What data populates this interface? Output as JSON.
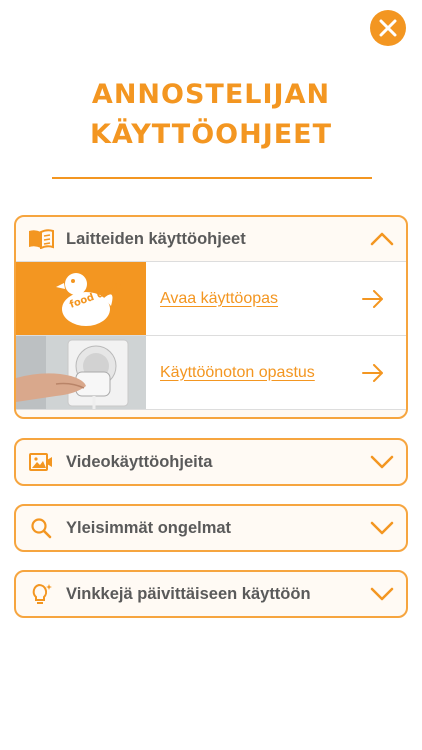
{
  "title": {
    "line1": "ANNOSTELIJAN",
    "line2": "KÄYTTÖOHJEET"
  },
  "close_icon": "close-icon",
  "sections": [
    {
      "label": "Laitteiden käyttöohjeet",
      "icon": "book-icon",
      "expanded": true,
      "items": [
        {
          "label": "Avaa käyttöopas",
          "thumbnail": "foodduck-logo",
          "logo_text": "food duck"
        },
        {
          "label": "Käyttöönoton opastus",
          "thumbnail": "hand-plugging-device-photo"
        }
      ]
    },
    {
      "label": "Videokäyttöohjeita",
      "icon": "image-icon",
      "expanded": false
    },
    {
      "label": "Yleisimmät ongelmat",
      "icon": "search-icon",
      "expanded": false
    },
    {
      "label": "Vinkkejä päivittäiseen käyttöön",
      "icon": "lightbulb-icon",
      "expanded": false
    }
  ],
  "colors": {
    "accent": "#f39621",
    "border": "#f6a53f",
    "text": "#5a5a5a",
    "header_bg": "#fffaf4"
  }
}
